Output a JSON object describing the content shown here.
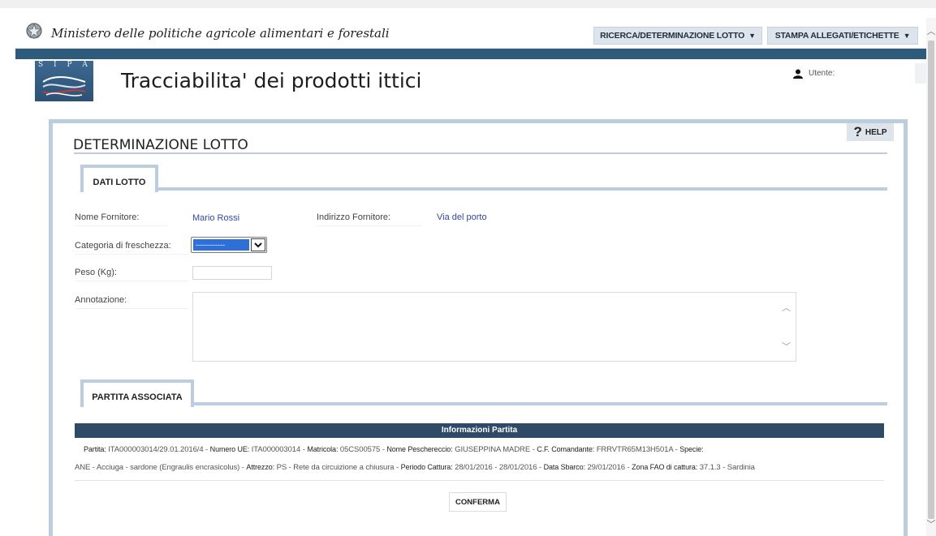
{
  "topbar": {
    "ministry_title": "Ministero delle politiche agricole alimentari e forestali",
    "nav": [
      {
        "label": "RICERCA/DETERMINAZIONE LOTTO",
        "caret": "▼"
      },
      {
        "label": "STAMPA ALLEGATI/ETICHETTE",
        "caret": "▼"
      }
    ]
  },
  "header": {
    "logo_text": "S I P A",
    "app_title": "Tracciabilita' dei prodotti ittici",
    "user_label": "Utente:"
  },
  "panel": {
    "help_label": "HELP",
    "help_icon": "?",
    "page_title": "DETERMINAZIONE LOTTO",
    "tab_dati": "DATI LOTTO",
    "tab_partita": "PARTITA ASSOCIATA"
  },
  "form": {
    "nome_fornitore_label": "Nome Fornitore:",
    "nome_fornitore_value": "Mario Rossi",
    "indirizzo_fornitore_label": "Indirizzo Fornitore:",
    "indirizzo_fornitore_value": "Via del porto",
    "categoria_label": "Categoria di freschezza:",
    "categoria_selected": "------------",
    "peso_label": "Peso (Kg):",
    "peso_value": "",
    "annotazione_label": "Annotazione:",
    "annotazione_value": ""
  },
  "partita": {
    "header": "Informazioni Partita",
    "fields": {
      "partita_label": "Partita:",
      "partita_value": "ITA000003014/29.01.2016/4",
      "numero_ue_label": "Numero UE:",
      "numero_ue_value": "ITA000003014",
      "matricola_label": "Matricola:",
      "matricola_value": "05CS00575",
      "peschereccio_label": "Nome Peschereccio:",
      "peschereccio_value": "GIUSEPPINA MADRE",
      "cf_label": "C.F. Comandante:",
      "cf_value": "FRRVTR65M13H501A",
      "specie_label": "Specie:",
      "specie_value": "ANE - Acciuga - sardone (Engraulis encrasicolus)",
      "attrezzo_label": "Attrezzo:",
      "attrezzo_value": "PS - Rete da circuizione a chiusura",
      "periodo_label": "Periodo Cattura:",
      "periodo_value": "28/01/2016 - 28/01/2016",
      "sbarco_label": "Data Sbarco:",
      "sbarco_value": "29/01/2016",
      "zona_label": "Zona FAO di cattura:",
      "zona_value": "37.1.3 - Sardinia"
    },
    "separator": "-"
  },
  "actions": {
    "confirm_label": "CONFERMA"
  },
  "colors": {
    "accent_dark": "#2e5a7c",
    "panel_border": "#bccddf",
    "info_header": "#2e4a66",
    "link_value": "#3347a0"
  }
}
